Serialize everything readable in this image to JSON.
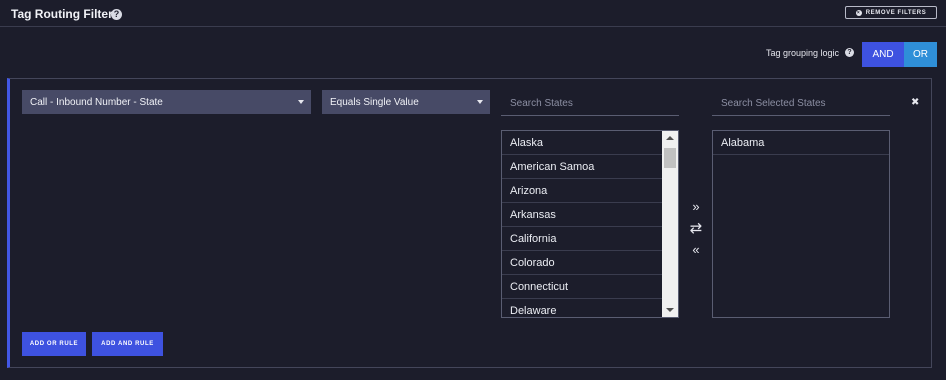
{
  "header": {
    "title": "Tag Routing Filters",
    "help_glyph": "?",
    "remove_filters_label": "REMOVE FILTERS",
    "remove_glyph": "×"
  },
  "logic": {
    "label": "Tag grouping logic",
    "help_glyph": "?",
    "options": [
      "AND",
      "OR"
    ],
    "selected": "AND"
  },
  "rule": {
    "field_value": "Call - Inbound Number - State",
    "operator_value": "Equals Single Value",
    "search_states_placeholder": "Search States",
    "search_selected_placeholder": "Search Selected States",
    "close_glyph": "✖",
    "available_states": [
      "Alaska",
      "American Samoa",
      "Arizona",
      "Arkansas",
      "California",
      "Colorado",
      "Connecticut",
      "Delaware"
    ],
    "selected_states": [
      "Alabama"
    ],
    "move_right_glyph": "»",
    "swap_glyph": "⇄",
    "move_left_glyph": "«"
  },
  "actions": {
    "add_or_rule": "ADD OR RULE",
    "add_and_rule": "ADD AND RULE"
  },
  "colors": {
    "background": "#1c1d2b",
    "accent": "#3e52e0",
    "or_button": "#2f8fd8",
    "dropdown": "#474a66"
  }
}
